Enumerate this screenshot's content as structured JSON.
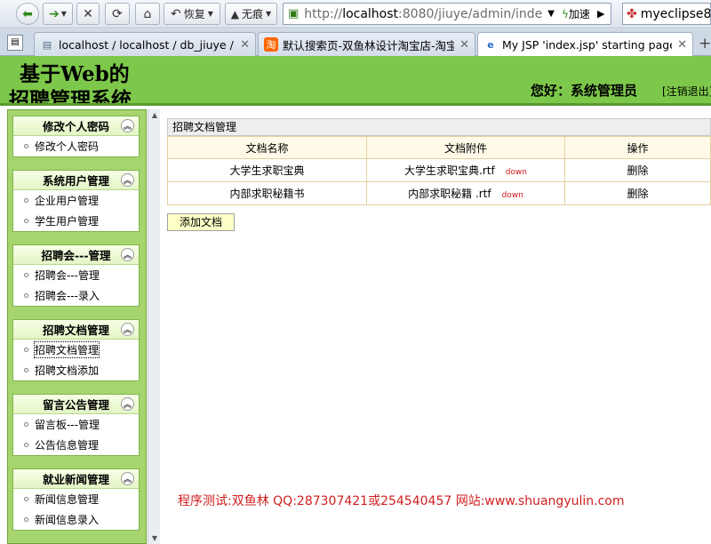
{
  "browser": {
    "restore_label": "恢复",
    "no_trace_label": "无痕",
    "url_prefix": "http://",
    "url_host": "localhost",
    "url_rest": ":8080/jiuye/admin/inde",
    "accelerate_label": "加速",
    "search_text": "myeclipse8",
    "tabs": [
      {
        "title": "localhost / localhost / db_jiuye / t_...",
        "favicon": "▤"
      },
      {
        "title": "默认搜索页-双鱼林设计淘宝店-淘宝网",
        "favicon": "淘"
      },
      {
        "title": "My JSP 'index.jsp' starting page",
        "favicon": "e"
      }
    ],
    "new_tab": "+"
  },
  "header": {
    "title_line1": "基于Web的",
    "title_line2": "招聘管理系统",
    "greeting": "您好：系统管理员",
    "logout": "[注销退出]"
  },
  "sidebar": {
    "groups": [
      {
        "title": "修改个人密码",
        "items": [
          "修改个人密码"
        ]
      },
      {
        "title": "系统用户管理",
        "items": [
          "企业用户管理",
          "学生用户管理"
        ]
      },
      {
        "title": "招聘会---管理",
        "items": [
          "招聘会---管理",
          "招聘会---录入"
        ]
      },
      {
        "title": "招聘文档管理",
        "items": [
          "招聘文档管理",
          "招聘文档添加"
        ]
      },
      {
        "title": "留言公告管理",
        "items": [
          "留言板---管理",
          "公告信息管理"
        ]
      },
      {
        "title": "就业新闻管理",
        "items": [
          "新闻信息管理",
          "新闻信息录入"
        ]
      }
    ]
  },
  "main": {
    "panel_title": "招聘文档管理",
    "columns": [
      "文档名称",
      "文档附件",
      "操作"
    ],
    "rows": [
      {
        "name": "大学生求职宝典",
        "attachment": "大学生求职宝典.rtf",
        "download": "down",
        "action": "删除"
      },
      {
        "name": "内部求职秘籍书",
        "attachment": "内部求职秘籍 .rtf",
        "download": "down",
        "action": "删除"
      }
    ],
    "add_button": "添加文档",
    "footer_note": "程序测试:双鱼林 QQ:287307421或254540457 网站:www.shuangyulin.com"
  }
}
